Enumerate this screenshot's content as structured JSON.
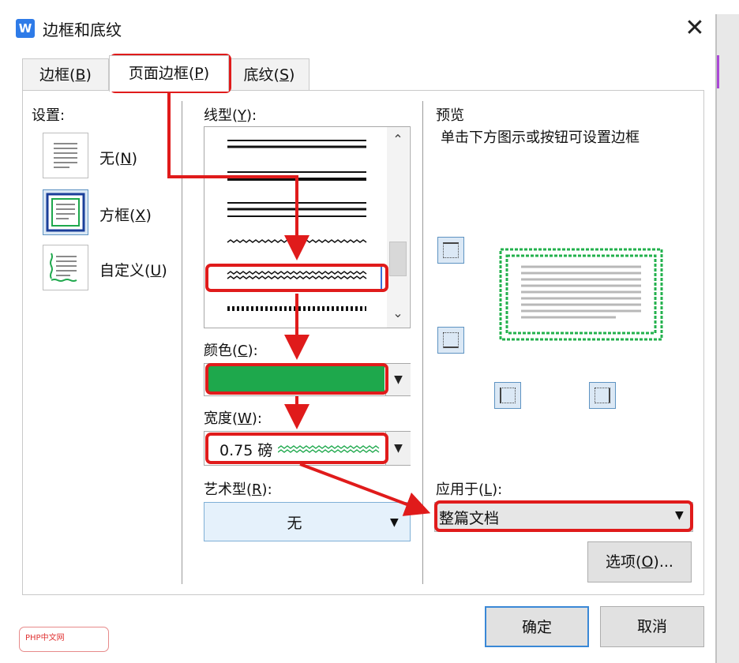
{
  "window": {
    "title": "边框和底纹",
    "app_icon": "wps-writer-icon"
  },
  "tabs": [
    {
      "prefix": "边框(",
      "key": "B",
      "suffix": ")"
    },
    {
      "prefix": "页面边框(",
      "key": "P",
      "suffix": ")"
    },
    {
      "prefix": "底纹(",
      "key": "S",
      "suffix": ")"
    }
  ],
  "settings": {
    "label": "设置:",
    "items": [
      {
        "prefix": "无(",
        "key": "N",
        "suffix": ")"
      },
      {
        "prefix": "方框(",
        "key": "X",
        "suffix": ")"
      },
      {
        "prefix": "自定义(",
        "key": "U",
        "suffix": ")"
      }
    ]
  },
  "line_style": {
    "prefix": "线型(",
    "key": "Y",
    "suffix": "):"
  },
  "color": {
    "prefix": "颜色(",
    "key": "C",
    "suffix": "):",
    "value": "#1ea84c"
  },
  "width": {
    "prefix": "宽度(",
    "key": "W",
    "suffix": "):",
    "value": "0.75 磅"
  },
  "art": {
    "prefix": "艺术型(",
    "key": "R",
    "suffix": "):",
    "value": "无"
  },
  "preview": {
    "title": "预览",
    "hint": "单击下方图示或按钮可设置边框"
  },
  "apply_to": {
    "prefix": "应用于(",
    "key": "L",
    "suffix": "):",
    "value": "整篇文档"
  },
  "buttons": {
    "options_prefix": "选项(",
    "options_key": "O",
    "options_suffix": ")...",
    "ok": "确定",
    "cancel": "取消"
  },
  "watermark": "PHP中文网",
  "colors": {
    "border_green": "#23b14d",
    "annotation_red": "#e01b1b",
    "tab_active": "#ffffff"
  }
}
